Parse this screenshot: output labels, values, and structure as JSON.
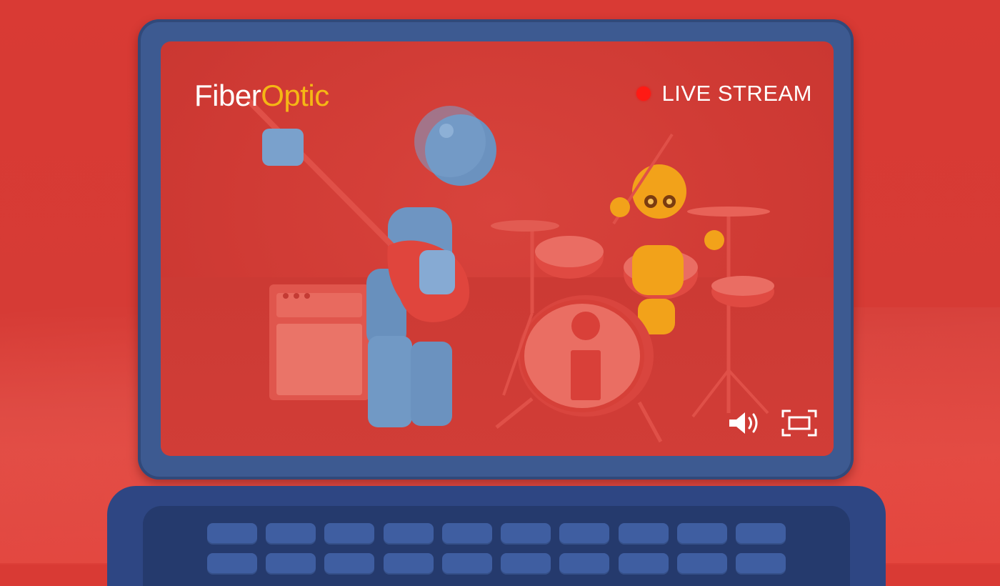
{
  "brand": {
    "part1": "Fiber",
    "part2": "Optic",
    "colors": {
      "white": "#ffffff",
      "yellow": "#f5b715"
    }
  },
  "stream": {
    "status_label": "LIVE STREAM",
    "live_color": "#ff1a14"
  },
  "player_controls": {
    "volume_icon": "speaker-volume-icon",
    "fullscreen_icon": "fullscreen-icon"
  },
  "scene": {
    "background_color": "#d63b35",
    "laptop_color": "#3d5a91"
  }
}
